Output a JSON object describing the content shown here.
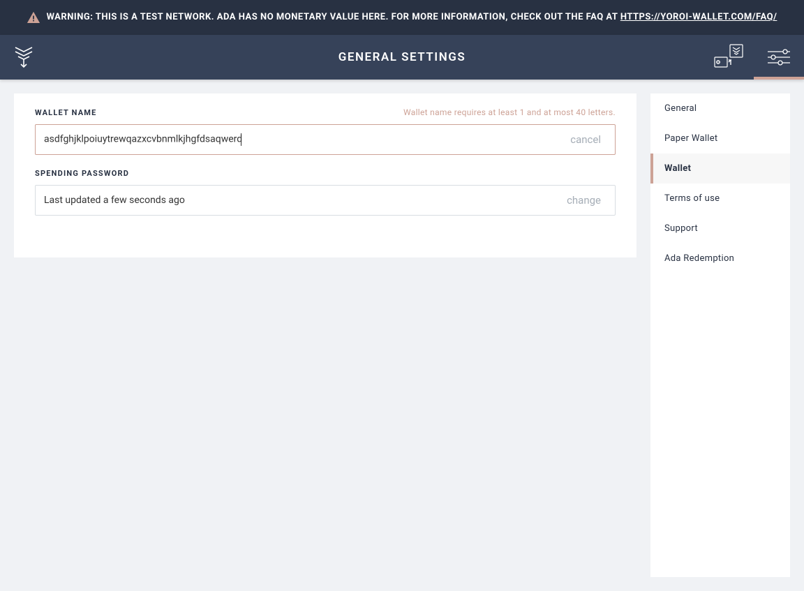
{
  "warning": {
    "text_prefix": "WARNING: THIS IS A TEST NETWORK. ADA HAS NO MONETARY VALUE HERE. FOR MORE INFORMATION, CHECK OUT THE FAQ AT ",
    "link_text": "HTTPS://YOROI-WALLET.COM/FAQ/"
  },
  "header": {
    "title": "GENERAL SETTINGS"
  },
  "wallet_name": {
    "label": "WALLET NAME",
    "error": "Wallet name requires at least 1 and at most 40 letters.",
    "value": "asdfghjklpoiuytrewqazxcvbnmlkjhgfdsaqwerd",
    "action": "cancel"
  },
  "spending_password": {
    "label": "SPENDING PASSWORD",
    "value": "Last updated a few seconds ago",
    "action": "change"
  },
  "sidebar": {
    "items": [
      {
        "label": "General"
      },
      {
        "label": "Paper Wallet"
      },
      {
        "label": "Wallet"
      },
      {
        "label": "Terms of use"
      },
      {
        "label": "Support"
      },
      {
        "label": "Ada Redemption"
      }
    ],
    "active_index": 2
  },
  "colors": {
    "accent": "#cda296",
    "dark": "#283142",
    "header": "#364259"
  }
}
